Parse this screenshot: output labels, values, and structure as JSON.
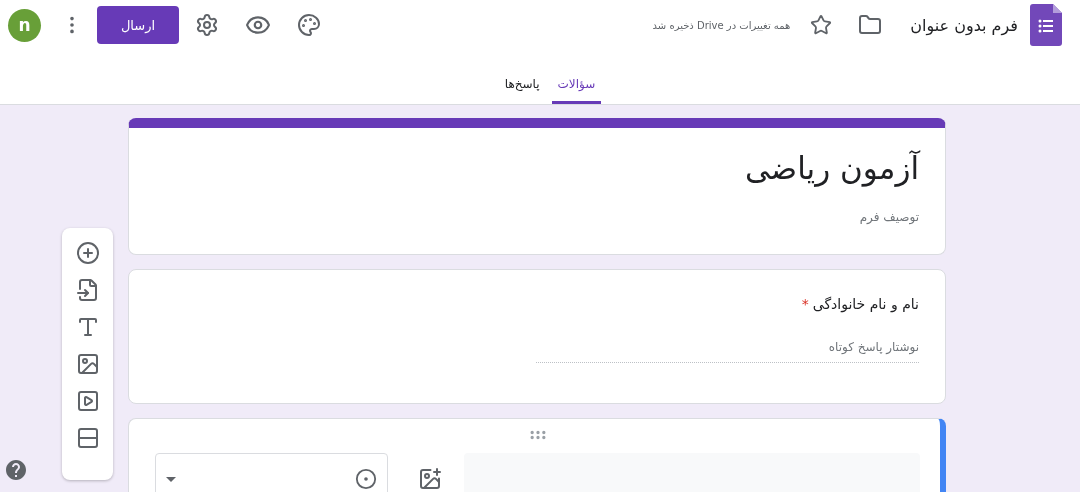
{
  "header": {
    "form_title": "فرم بدون عنوان",
    "save_status": "همه تغییرات در Drive ذخیره شد",
    "send_button": "ارسال",
    "avatar": "n"
  },
  "tabs": [
    {
      "label": "سؤالات",
      "selected": true
    },
    {
      "label": "پاسخ‌ها",
      "selected": false
    }
  ],
  "form": {
    "title": "آزمون ریاضی",
    "description_placeholder": "توصیف فرم"
  },
  "questions": [
    {
      "kind": "short_answer",
      "title": "نام و نام خانوادگی",
      "required_mark": "*",
      "answer_placeholder": "نوشتار پاسخ کوتاه",
      "selected": false
    },
    {
      "kind": "editor",
      "selected": true
    }
  ]
}
